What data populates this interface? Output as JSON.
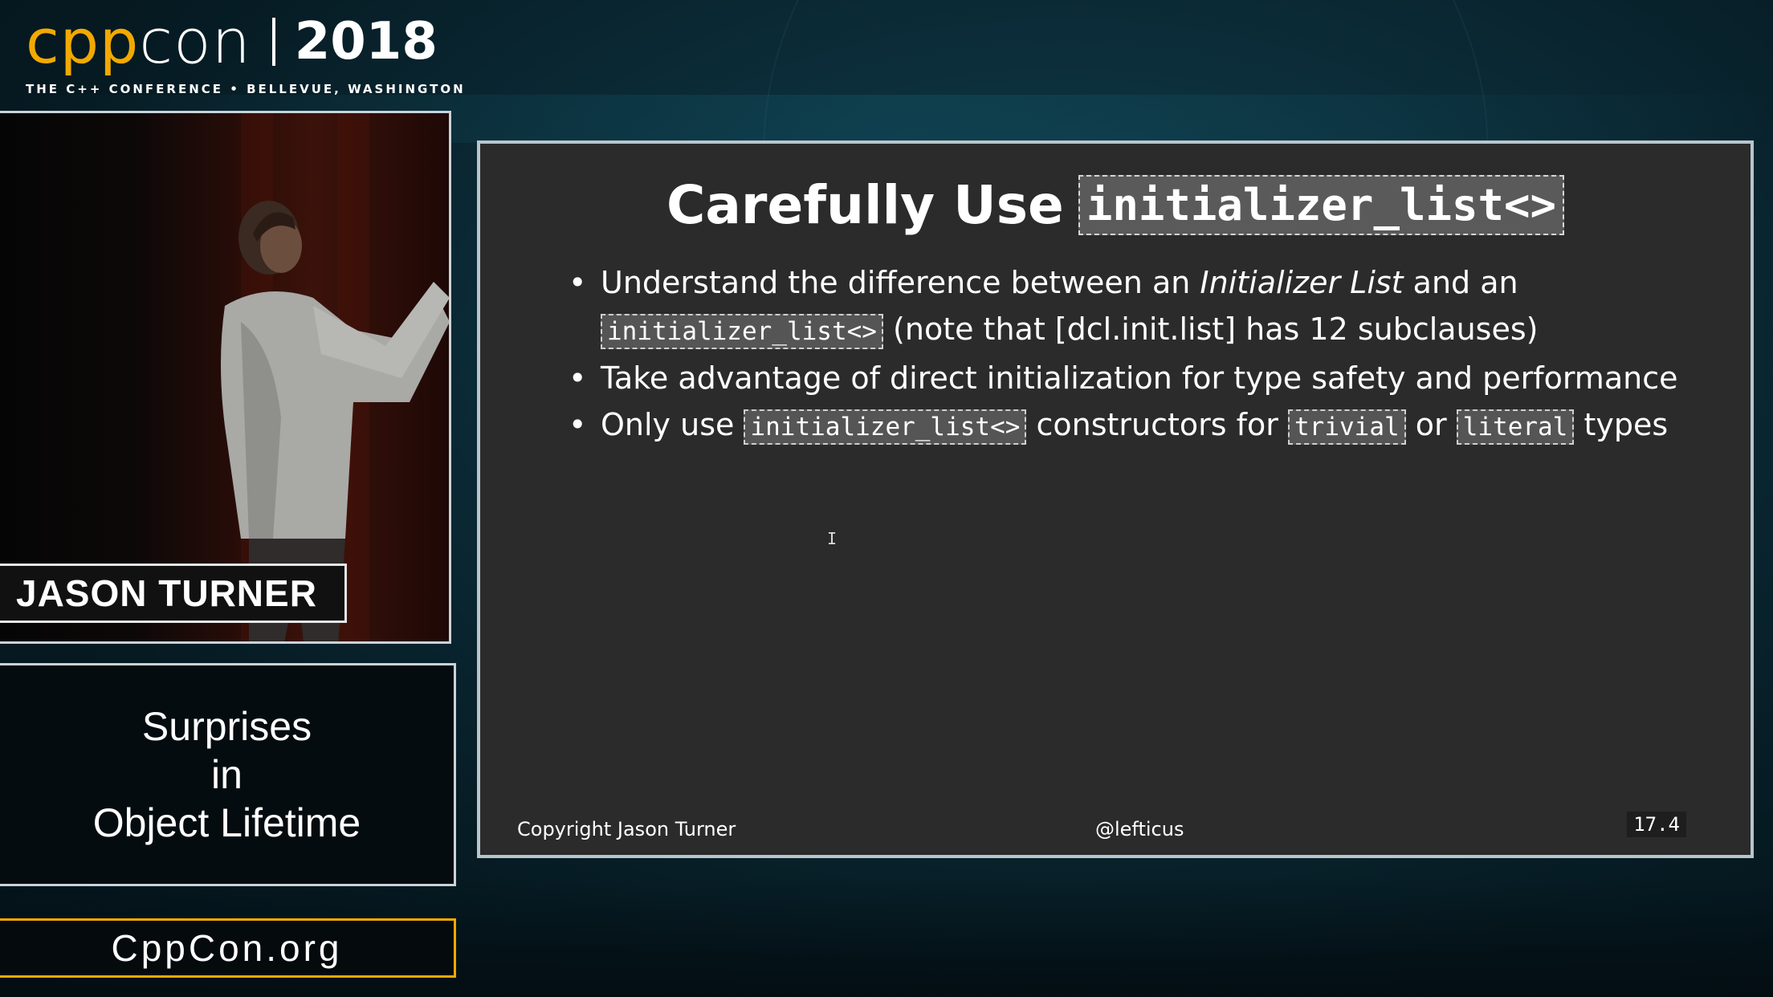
{
  "logo": {
    "cpp": "cpp",
    "con": "con",
    "year": "2018",
    "tagline": "THE C++ CONFERENCE • BELLEVUE, WASHINGTON"
  },
  "speaker": {
    "name": "JASON TURNER"
  },
  "talk": {
    "line1": "Surprises",
    "line2": "in",
    "line3": "Object Lifetime"
  },
  "website": "CppCon.org",
  "slide": {
    "title_text": "Carefully Use",
    "title_code": "initializer_list<>",
    "bullet1": {
      "part1": "Understand the difference between an ",
      "italic": "Initializer List",
      "part2": " and an ",
      "code": "initializer_list<>",
      "part3": " (note that [dcl.init.list] has 12 subclauses)"
    },
    "bullet2": "Take advantage of direct initialization for type safety and performance",
    "bullet3": {
      "part1": "Only use ",
      "code1": "initializer_list<>",
      "part2": " constructors for ",
      "code2": "trivial",
      "part3": " or ",
      "code3": "literal",
      "part4": " types"
    },
    "footer_left": "Copyright Jason Turner",
    "footer_mid": "@lefticus",
    "footer_right": "17.4"
  },
  "colors": {
    "brand_orange": "#f2a900",
    "slide_bg": "#2b2b2b",
    "code_bg": "#555555"
  }
}
